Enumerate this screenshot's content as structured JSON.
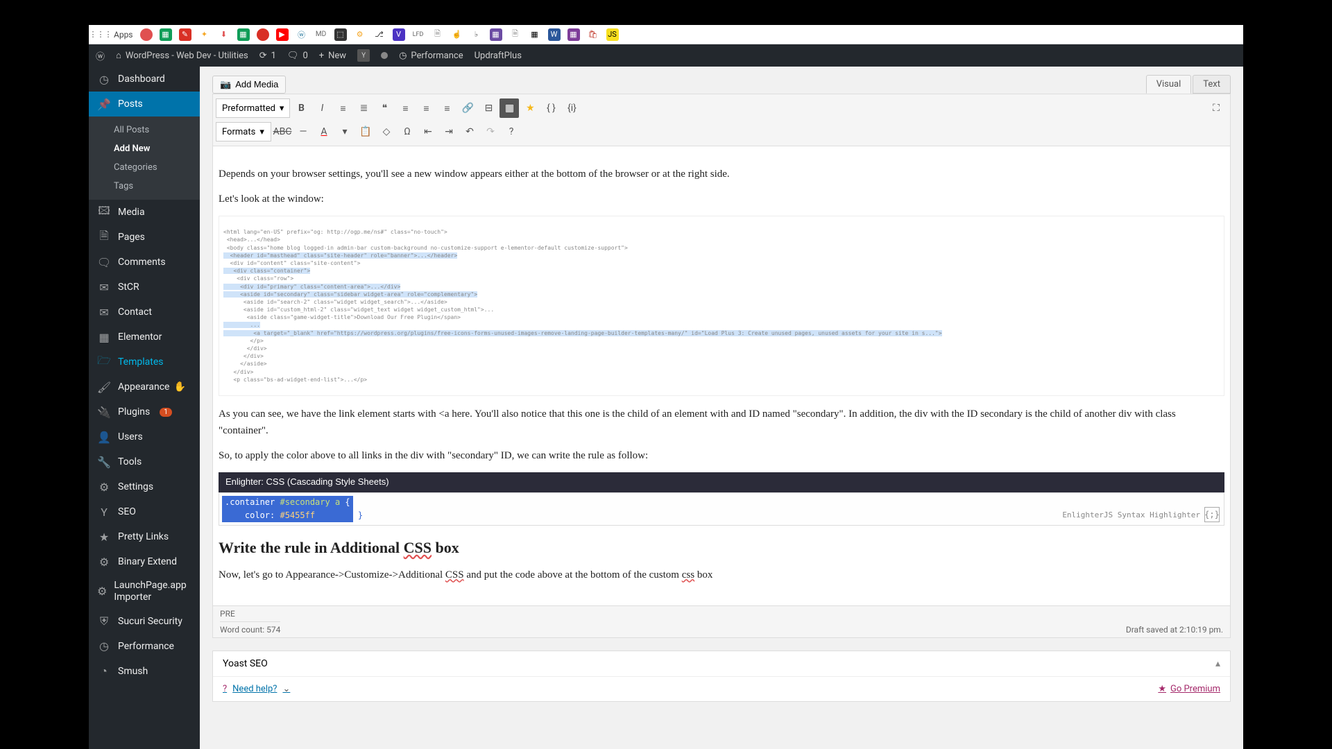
{
  "bookmarks": {
    "apps_label": "Apps"
  },
  "adminbar": {
    "site_title": "WordPress - Web Dev - Utilities",
    "updates_count": "1",
    "comments_count": "0",
    "new_label": "New",
    "performance": "Performance",
    "updraft": "UpdraftPlus"
  },
  "sidebar": {
    "dashboard": "Dashboard",
    "posts": "Posts",
    "posts_sub": {
      "all": "All Posts",
      "add": "Add New",
      "cats": "Categories",
      "tags": "Tags"
    },
    "media": "Media",
    "pages": "Pages",
    "comments": "Comments",
    "stcr": "StCR",
    "contact": "Contact",
    "elementor": "Elementor",
    "templates": "Templates",
    "appearance": "Appearance",
    "plugins": "Plugins",
    "plugins_badge": "1",
    "users": "Users",
    "tools": "Tools",
    "settings": "Settings",
    "seo": "SEO",
    "pretty": "Pretty Links",
    "binary": "Binary Extend",
    "launchpage": "LaunchPage.app Importer",
    "sucuri": "Sucuri Security",
    "performance": "Performance",
    "smush": "Smush"
  },
  "editor": {
    "add_media": "Add Media",
    "tab_visual": "Visual",
    "tab_text": "Text",
    "format_select": "Preformatted",
    "formats_select": "Formats",
    "para1": "Depends on your browser settings, you'll see a new window appears either at the bottom of the browser or at the right side.",
    "para2": "Let's look at the window:",
    "para3a": "As you can see, we have the link element starts with <a here. You'll also notice that this one is the child of an element with and ID named \"secondary\". In addition, the div with the ID secondary is the child of another div with class \"container\".",
    "para4": "So, to apply the color above to all links in the div with \"secondary\" ID, we can write the rule as follow:",
    "enlighter_title": "Enlighter: CSS (Cascading Style Sheets)",
    "code_line1a": ".container ",
    "code_line1b": "#secondary a",
    "code_line1c": " {",
    "code_line2a": "    color",
    "code_line2b": ": ",
    "code_line2c": "#5455ff",
    "code_line3": "}",
    "enlighter_credit": "EnlighterJS Syntax Highlighter",
    "h2_a": "Write the rule in Additional ",
    "h2_css": "CSS",
    "h2_b": " box",
    "para5a": "Now, let's go to Appearance->Customize->Additional ",
    "para5_css": "CSS",
    "para5b": " and put the code above at the bottom of the custom ",
    "para5_css2": "css",
    "para5c": " box",
    "path": "PRE",
    "word_count": "Word count: 574",
    "draft_saved": "Draft saved at 2:10:19 pm."
  },
  "yoast": {
    "title": "Yoast SEO",
    "need_help": "Need help?",
    "go_premium": "Go Premium"
  }
}
